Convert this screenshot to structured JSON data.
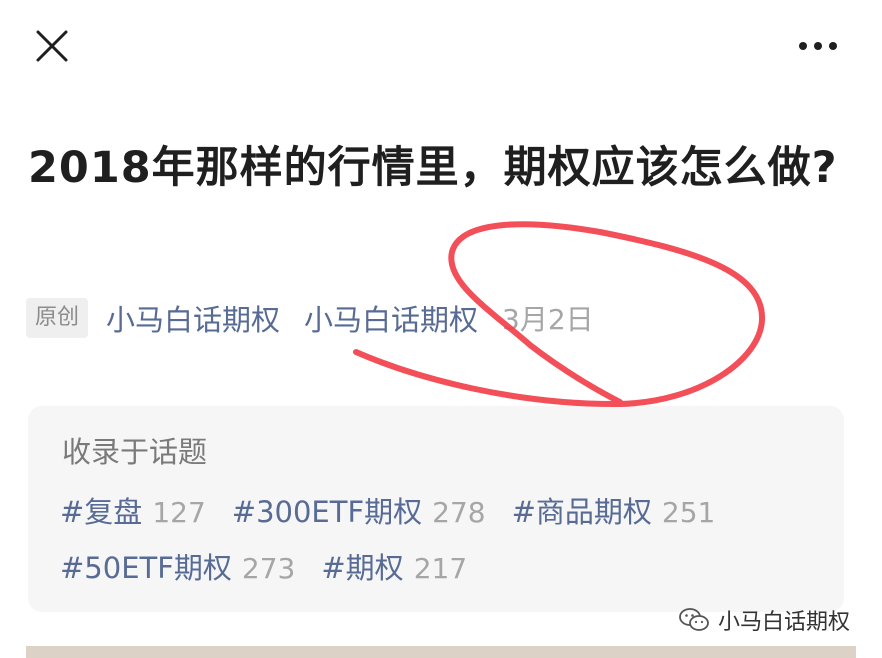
{
  "article": {
    "title": "2018年那样的行情里，期权应该怎么做?",
    "original_badge": "原创",
    "author": "小马白话期权",
    "account": "小马白话期权",
    "date": "3月2日"
  },
  "topics": {
    "heading": "收录于话题",
    "tags": [
      {
        "name": "#复盘",
        "count": "127"
      },
      {
        "name": "#300ETF期权",
        "count": "278"
      },
      {
        "name": "#商品期权",
        "count": "251"
      },
      {
        "name": "#50ETF期权",
        "count": "273"
      },
      {
        "name": "#期权",
        "count": "217"
      }
    ]
  },
  "watermark": {
    "text": "小马白话期权",
    "icon": "wechat-icon"
  },
  "icons": {
    "close": "close-icon",
    "more": "more-icon"
  },
  "colors": {
    "link": "#576b95",
    "annotation": "#f2404a",
    "card_bg": "#f6f6f7"
  }
}
